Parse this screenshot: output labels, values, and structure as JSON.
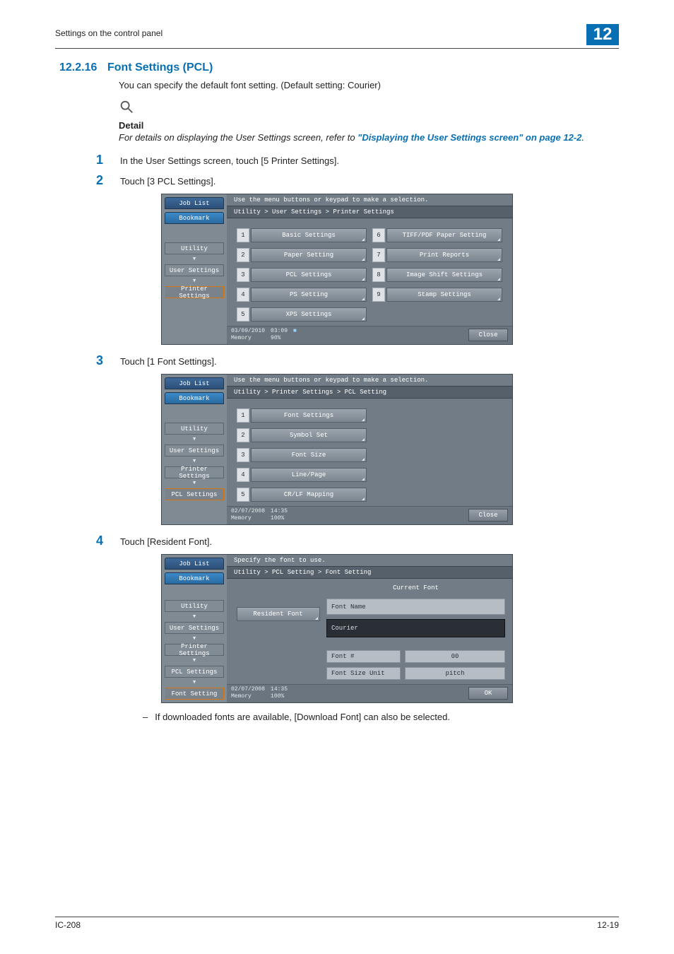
{
  "header": {
    "running_head": "Settings on the control panel",
    "chapter_number": "12"
  },
  "section": {
    "number": "12.2.16",
    "title": "Font Settings (PCL)"
  },
  "intro": "You can specify the default font setting. (Default setting: Courier)",
  "detail": {
    "heading": "Detail",
    "body_prefix": "For details on displaying the User Settings screen, refer to ",
    "link_text": "\"Displaying the User Settings screen\" on page 12-2",
    "body_suffix": "."
  },
  "steps": {
    "s1": {
      "num": "1",
      "text": "In the User Settings screen, touch [5 Printer Settings]."
    },
    "s2": {
      "num": "2",
      "text": "Touch [3 PCL Settings]."
    },
    "s3": {
      "num": "3",
      "text": "Touch [1 Font Settings]."
    },
    "s4": {
      "num": "4",
      "text": "Touch [Resident Font]."
    }
  },
  "note": "If downloaded fonts are available, [Download Font] can also be selected.",
  "footer": {
    "left": "IC-208",
    "right": "12-19"
  },
  "screen1": {
    "joblist": "Job List",
    "bookmark": "Bookmark",
    "topmsg": "Use the menu buttons or keypad to make a selection.",
    "crumb": "Utility > User Settings > Printer Settings",
    "side": {
      "utility": "Utility",
      "user_settings": "User Settings",
      "printer_settings": "Printer Settings"
    },
    "left_options": [
      {
        "n": "1",
        "label": "Basic Settings"
      },
      {
        "n": "2",
        "label": "Paper Setting"
      },
      {
        "n": "3",
        "label": "PCL Settings"
      },
      {
        "n": "4",
        "label": "PS Setting"
      },
      {
        "n": "5",
        "label": "XPS Settings"
      }
    ],
    "right_options": [
      {
        "n": "6",
        "label": "TIFF/PDF Paper Setting"
      },
      {
        "n": "7",
        "label": "Print Reports"
      },
      {
        "n": "8",
        "label": "Image Shift Settings"
      },
      {
        "n": "9",
        "label": "Stamp Settings"
      }
    ],
    "status": {
      "date": "03/09/2010",
      "time": "03:09",
      "mem_label": "Memory",
      "mem_val": "90%",
      "close": "Close"
    }
  },
  "screen2": {
    "joblist": "Job List",
    "bookmark": "Bookmark",
    "topmsg": "Use the menu buttons or keypad to make a selection.",
    "crumb": "Utility > Printer Settings > PCL Setting",
    "side": {
      "utility": "Utility",
      "user_settings": "User Settings",
      "printer_settings": "Printer Settings",
      "pcl_settings": "PCL Settings"
    },
    "options": [
      {
        "n": "1",
        "label": "Font Settings"
      },
      {
        "n": "2",
        "label": "Symbol Set"
      },
      {
        "n": "3",
        "label": "Font Size"
      },
      {
        "n": "4",
        "label": "Line/Page"
      },
      {
        "n": "5",
        "label": "CR/LF Mapping"
      }
    ],
    "status": {
      "date": "02/07/2008",
      "time": "14:35",
      "mem_label": "Memory",
      "mem_val": "100%",
      "close": "Close"
    }
  },
  "screen3": {
    "joblist": "Job List",
    "bookmark": "Bookmark",
    "topmsg": "Specify the font to use.",
    "crumb": "Utility > PCL Setting > Font Setting",
    "side": {
      "utility": "Utility",
      "user_settings": "User Settings",
      "printer_settings": "Printer Settings",
      "pcl_settings": "PCL Settings",
      "font_setting": "Font Setting"
    },
    "resident_font": "Resident Font",
    "current_font_title": "Current Font",
    "fields": {
      "font_name_label": "Font Name",
      "font_name_value": "Courier",
      "font_num_label": "Font #",
      "font_num_value": "00",
      "font_size_unit_label": "Font Size Unit",
      "font_size_unit_value": "pitch"
    },
    "status": {
      "date": "02/07/2008",
      "time": "14:35",
      "mem_label": "Memory",
      "mem_val": "100%",
      "ok": "OK"
    }
  }
}
